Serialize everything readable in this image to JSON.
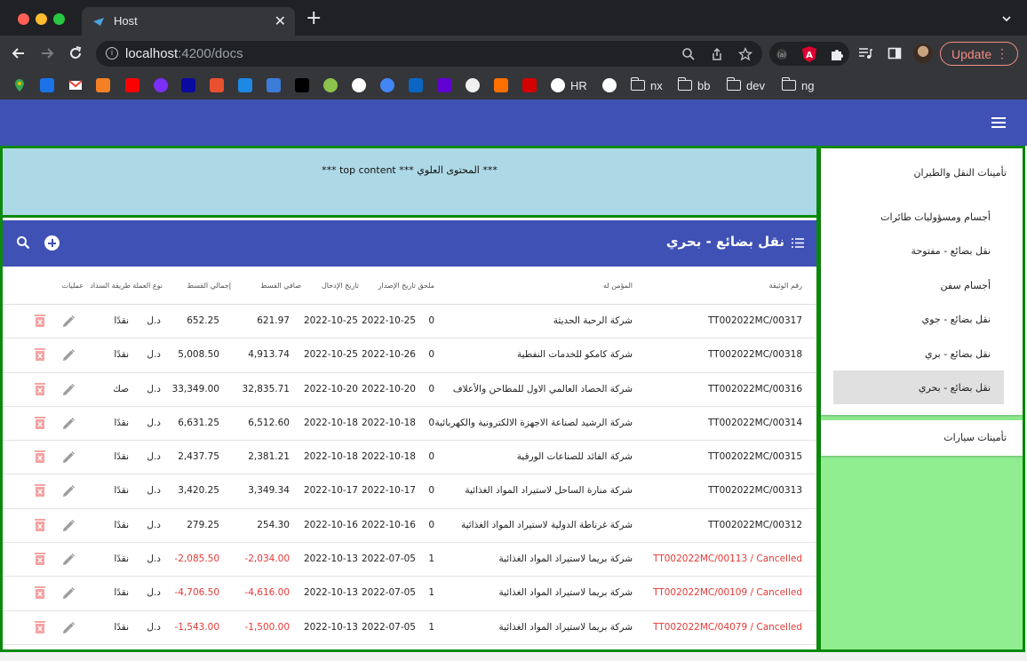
{
  "browser": {
    "tab_title": "Host",
    "url_host": "localhost",
    "url_rest": ":4200/docs",
    "update_label": "Update",
    "bookmarks": [
      {
        "label": "HR"
      },
      {
        "label": "nx"
      },
      {
        "label": "bb"
      },
      {
        "label": "dev"
      },
      {
        "label": "ng"
      }
    ],
    "colors": {
      "accent_red": "#f28b82"
    }
  },
  "app": {
    "top_content": "*** المحتوى العلوي *** top content ***",
    "list_title": "نقل بضائع - بحري",
    "columns": {
      "policy_no": "رقم الوثيقة",
      "insured": "المؤمن له",
      "annex": "ملحق",
      "issue_date": "تاريخ الإصدار",
      "entry_date": "تاريخ الإدخال",
      "net_premium": "صافي القسط",
      "total_premium": "إجمالي القسط",
      "currency": "نوع العملة",
      "payment": "طريقة السداد",
      "ops": "عمليات"
    },
    "rows": [
      {
        "policy": "TT002022MC/00317",
        "insured": "شركة الرحبة الحديثة",
        "annex": "0",
        "issue": "2022-10-25",
        "entry": "2022-10-25",
        "net": "621.97",
        "total": "652.25",
        "currency": "د.ل",
        "payment": "نقدًا",
        "cancelled": false
      },
      {
        "policy": "TT002022MC/00318",
        "insured": "شركة كامكو للخدمات النفطية",
        "annex": "0",
        "issue": "2022-10-26",
        "entry": "2022-10-25",
        "net": "4,913.74",
        "total": "5,008.50",
        "currency": "د.ل",
        "payment": "نقدًا",
        "cancelled": false
      },
      {
        "policy": "TT002022MC/00316",
        "insured": "شركة الحصاد العالمي الاول للمطاحن والأعلاف",
        "annex": "0",
        "issue": "2022-10-20",
        "entry": "2022-10-20",
        "net": "32,835.71",
        "total": "33,349.00",
        "currency": "د.ل",
        "payment": "صك",
        "cancelled": false
      },
      {
        "policy": "TT002022MC/00314",
        "insured": "شركة الرشيد لصناعة الاجهزة الالكترونية والكهربائية",
        "annex": "0",
        "issue": "2022-10-18",
        "entry": "2022-10-18",
        "net": "6,512.60",
        "total": "6,631.25",
        "currency": "د.ل",
        "payment": "نقدًا",
        "cancelled": false
      },
      {
        "policy": "TT002022MC/00315",
        "insured": "شركة الفائد للصناعات الورقية",
        "annex": "0",
        "issue": "2022-10-18",
        "entry": "2022-10-18",
        "net": "2,381.21",
        "total": "2,437.75",
        "currency": "د.ل",
        "payment": "نقدًا",
        "cancelled": false
      },
      {
        "policy": "TT002022MC/00313",
        "insured": "شركة منارة الساحل لاستيراد المواد الغذائية",
        "annex": "0",
        "issue": "2022-10-17",
        "entry": "2022-10-17",
        "net": "3,349.34",
        "total": "3,420.25",
        "currency": "د.ل",
        "payment": "نقدًا",
        "cancelled": false
      },
      {
        "policy": "TT002022MC/00312",
        "insured": "شركة غرناطة الدولية لاستيراد المواد الغذائية",
        "annex": "0",
        "issue": "2022-10-16",
        "entry": "2022-10-16",
        "net": "254.30",
        "total": "279.25",
        "currency": "د.ل",
        "payment": "نقدًا",
        "cancelled": false
      },
      {
        "policy": "TT002022MC/00113 / Cancelled",
        "insured": "شركة بريما لاستيراد المواد الغذائية",
        "annex": "1",
        "issue": "2022-07-05",
        "entry": "2022-10-13",
        "net": "-2,034.00",
        "total": "-2,085.50",
        "currency": "د.ل",
        "payment": "نقدًا",
        "cancelled": true
      },
      {
        "policy": "TT002022MC/00109 / Cancelled",
        "insured": "شركة بريما لاستيراد المواد الغذائية",
        "annex": "1",
        "issue": "2022-07-05",
        "entry": "2022-10-13",
        "net": "-4,616.00",
        "total": "-4,706.50",
        "currency": "د.ل",
        "payment": "نقدًا",
        "cancelled": true
      },
      {
        "policy": "TT002022MC/04079 / Cancelled",
        "insured": "شركة بريما لاستيراد المواد الغذائية",
        "annex": "1",
        "issue": "2022-07-05",
        "entry": "2022-10-13",
        "net": "-1,500.00",
        "total": "-1,543.00",
        "currency": "د.ل",
        "payment": "نقدًا",
        "cancelled": true
      }
    ],
    "sidebar": {
      "group1_title": "تأمينات النقل والطيران",
      "items": [
        {
          "label": "أجسام ومسؤوليات طائرات",
          "active": false
        },
        {
          "label": "نقل بضائع - مفتوحة",
          "active": false
        },
        {
          "label": "أجسام سفن",
          "active": false
        },
        {
          "label": "نقل بضائع - جوي",
          "active": false
        },
        {
          "label": "نقل بضائع - بري",
          "active": false
        },
        {
          "label": "نقل بضائع - بحري",
          "active": true
        }
      ],
      "group2_title": "تأمينات سيارات"
    },
    "colors": {
      "primary": "#3f51b5",
      "panel_border": "#0b8a0b",
      "top_bg": "#add8e6",
      "sidebar_bg": "#90ee90",
      "cancelled": "#e53935"
    }
  }
}
